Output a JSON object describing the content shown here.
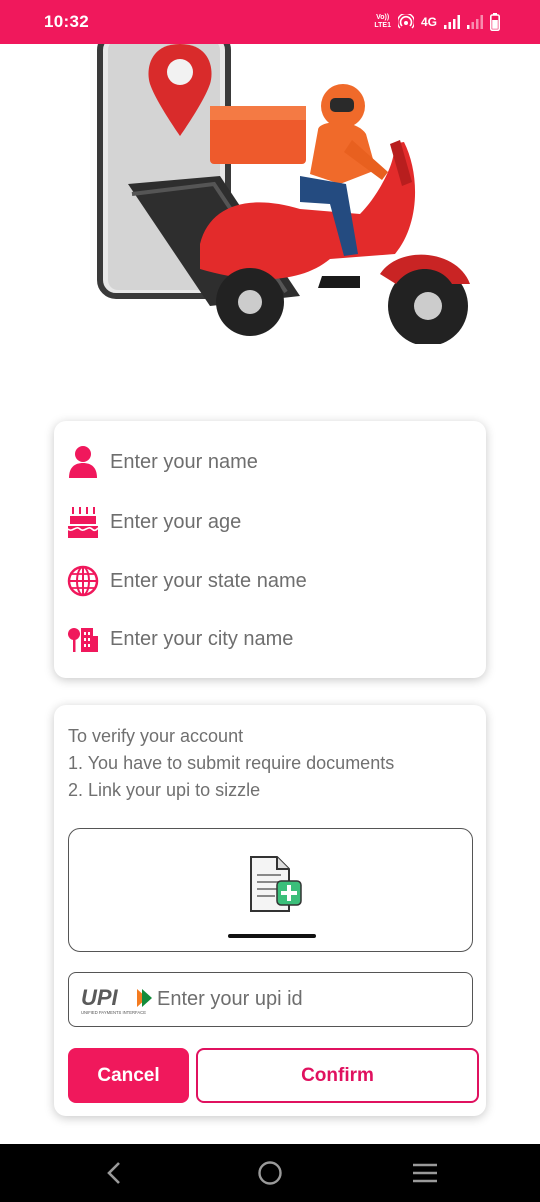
{
  "status_bar": {
    "time": "10:32",
    "volte_line1": "Vo))",
    "volte_line2": "LTE1",
    "network": "4G",
    "icons": [
      "volte-icon",
      "hotspot-icon",
      "signal-icon",
      "signal-weak-icon",
      "battery-icon"
    ]
  },
  "hero": {
    "image": "delivery-scooter-illustration"
  },
  "profile_form": {
    "name_placeholder": "Enter your name",
    "age_placeholder": "Enter your age",
    "state_placeholder": "Enter your state name",
    "city_placeholder": "Enter your city name",
    "icons": [
      "person-icon",
      "cake-icon",
      "globe-icon",
      "city-icon"
    ]
  },
  "verify": {
    "line1": "To verify your account",
    "line2": "1. You have to submit require documents",
    "line3": "2. Link your upi to sizzle",
    "upload_icon": "document-add-icon",
    "upi_logo_text": "UPI",
    "upi_logo_subtext": "UNIFIED PAYMENTS INTERFACE",
    "upi_placeholder": "Enter your upi id",
    "cancel_label": "Cancel",
    "confirm_label": "Confirm"
  },
  "nav_bar": {
    "icons": [
      "back-icon",
      "home-icon",
      "menu-icon"
    ]
  },
  "colors": {
    "accent": "#f0185c",
    "text": "#6e6e6e",
    "navbar": "#000000"
  }
}
